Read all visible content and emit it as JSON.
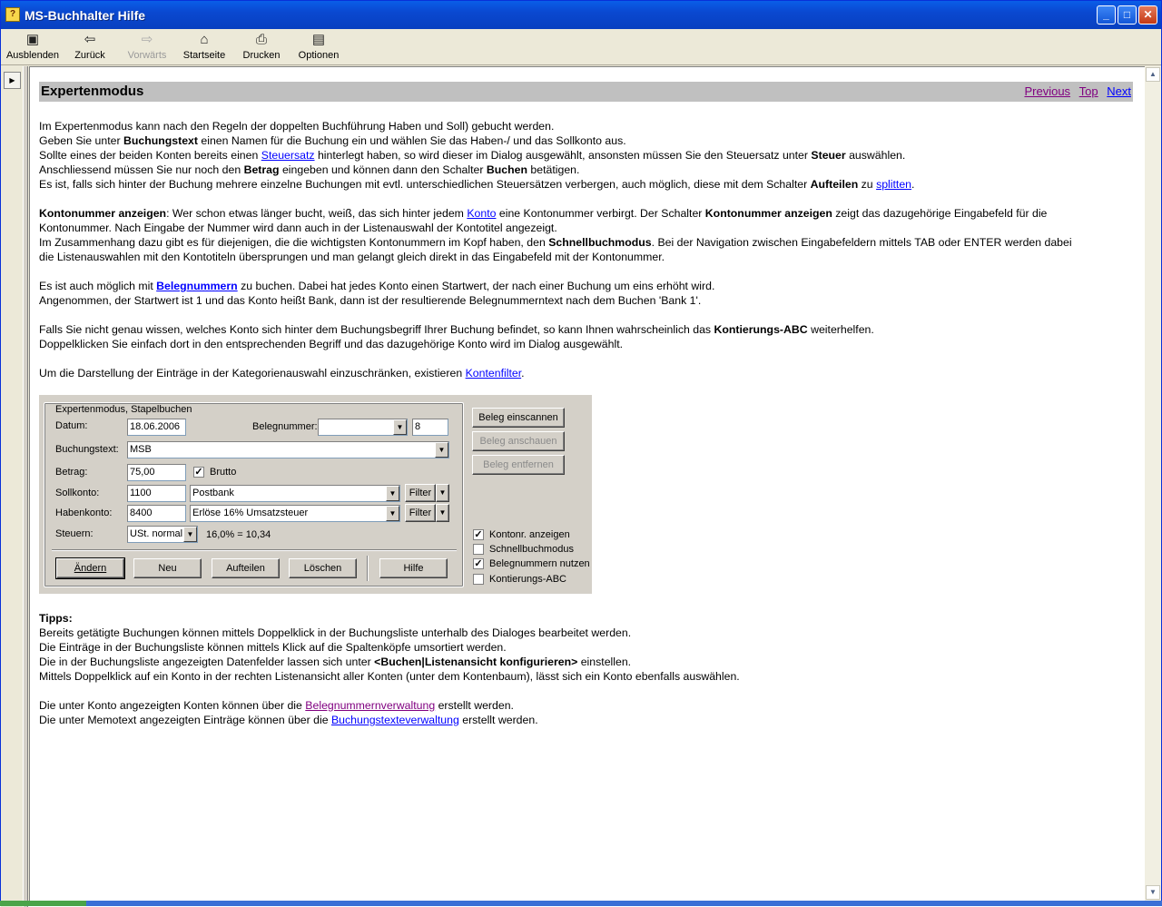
{
  "window": {
    "title": "MS-Buchhalter Hilfe"
  },
  "toolbar": {
    "hide": "Ausblenden",
    "back": "Zurück",
    "forward": "Vorwärts",
    "home": "Startseite",
    "print": "Drucken",
    "options": "Optionen"
  },
  "page": {
    "heading": "Expertenmodus",
    "nav": {
      "previous": "Previous",
      "top": "Top",
      "next": "Next"
    },
    "p1": {
      "l1": "Im Expertenmodus kann nach den Regeln der doppelten Buchführung Haben und Soll) gebucht werden.",
      "l2a": "Geben Sie unter ",
      "l2b": "Buchungstext",
      "l2c": " einen Namen für die Buchung ein und wählen Sie das Haben-/ und das Sollkonto aus.",
      "l3a": "Sollte eines der beiden Konten bereits einen ",
      "l3link": "Steuersatz",
      "l3b": " hinterlegt haben, so wird dieser im Dialog ausgewählt, ansonsten müssen Sie den Steuersatz unter ",
      "l3c": "Steuer",
      "l3d": " auswählen.",
      "l4a": "Anschliessend müssen Sie nur noch den ",
      "l4b": "Betrag",
      "l4c": " eingeben und können dann den Schalter ",
      "l4d": "Buchen",
      "l4e": " betätigen.",
      "l5a": "Es ist, falls sich hinter der Buchung mehrere einzelne Buchungen mit evtl. unterschiedlichen Steuersätzen verbergen, auch möglich, diese mit dem Schalter ",
      "l5b": "Aufteilen",
      "l5c": " zu ",
      "l5link": "splitten",
      "l5d": "."
    },
    "p2": {
      "l1a": "Kontonummer anzeigen",
      "l1b": ": Wer schon etwas länger bucht, weiß, das sich hinter jedem ",
      "l1link": "Konto",
      "l1c": " eine Kontonummer verbirgt. Der Schalter ",
      "l1d": "Kontonummer anzeigen",
      "l1e": " zeigt das dazugehörige Eingabefeld für die",
      "l2": "Kontonummer. Nach Eingabe der Nummer wird dann auch in der Listenauswahl der Kontotitel angezeigt.",
      "l3a": "Im Zusammenhang dazu gibt es für diejenigen, die die wichtigsten Kontonummern im Kopf haben, den ",
      "l3b": "Schnellbuchmodus",
      "l3c": ". Bei der Navigation zwischen Eingabefeldern mittels TAB oder ENTER werden dabei",
      "l4": "die Listenauswahlen mit den Kontotiteln übersprungen und man gelangt gleich direkt in das Eingabefeld mit der Kontonummer."
    },
    "p3": {
      "l1a": "Es ist auch möglich mit ",
      "l1link": "Belegnummern",
      "l1b": " zu buchen. Dabei hat jedes Konto einen Startwert, der nach einer Buchung um eins erhöht wird.",
      "l2": "Angenommen, der Startwert ist 1 und das Konto heißt Bank, dann ist der resultierende Belegnummerntext nach dem Buchen 'Bank 1'."
    },
    "p4": {
      "l1a": "Falls Sie nicht genau wissen, welches Konto sich hinter dem Buchungsbegriff Ihrer Buchung befindet, so kann Ihnen wahrscheinlich das ",
      "l1b": "Kontierungs-ABC",
      "l1c": " weiterhelfen.",
      "l2": "Doppelklicken Sie einfach dort in den entsprechenden Begriff und das dazugehörige Konto wird im Dialog ausgewählt."
    },
    "p5": {
      "l1a": "Um die Darstellung der Einträge in der Kategorienauswahl einzuschränken, existieren ",
      "l1link": "Kontenfilter",
      "l1b": "."
    },
    "tips": {
      "title": "Tipps:",
      "l1": "Bereits getätigte Buchungen können mittels Doppelklick in der Buchungsliste unterhalb des Dialoges bearbeitet werden.",
      "l2": "Die Einträge in der Buchungsliste können mittels Klick auf die Spaltenköpfe umsortiert werden.",
      "l3a": "Die in der Buchungsliste angezeigten Datenfelder lassen sich unter ",
      "l3b": "<Buchen|Listenansicht konfigurieren>",
      "l3c": " einstellen.",
      "l4": "Mittels Doppelklick auf ein Konto in der rechten Listenansicht aller Konten (unter dem Kontenbaum), lässt sich ein Konto ebenfalls auswählen."
    },
    "p6": {
      "l1a": "Die unter Konto angezeigten Konten können über die ",
      "l1link": "Belegnummernverwaltung",
      "l1b": " erstellt werden.",
      "l2a": "Die unter Memotext angezeigten Einträge können über die ",
      "l2link": "Buchungstexteverwaltung",
      "l2b": " erstellt werden."
    }
  },
  "dialog": {
    "group_title": "Expertenmodus, Stapelbuchen",
    "datum_label": "Datum:",
    "datum": "18.06.2006",
    "belegnr_label": "Belegnummer:",
    "belegnr_select": "",
    "belegnr": "8",
    "buchungstext_label": "Buchungstext:",
    "buchungstext": "MSB",
    "betrag_label": "Betrag:",
    "betrag": "75,00",
    "brutto_label": "Brutto",
    "brutto_checked": true,
    "soll_label": "Sollkonto:",
    "soll_nr": "1100",
    "soll_name": "Postbank",
    "haben_label": "Habenkonto:",
    "haben_nr": "8400",
    "haben_name": "Erlöse 16% Umsatzsteuer",
    "filter_label": "Filter",
    "steuer_label": "Steuern:",
    "steuer": "USt. normal",
    "steuer_calc": "16,0% = 10,34",
    "buttons": {
      "aendern": "Ändern",
      "neu": "Neu",
      "aufteilen": "Aufteilen",
      "loeschen": "Löschen",
      "hilfe": "Hilfe"
    },
    "side_buttons": {
      "scan": "Beleg einscannen",
      "view": "Beleg anschauen",
      "remove": "Beleg entfernen"
    },
    "options": {
      "kontonr": "Kontonr. anzeigen",
      "schnell": "Schnellbuchmodus",
      "belegnr": "Belegnummern nutzen",
      "abc": "Kontierungs-ABC"
    }
  }
}
